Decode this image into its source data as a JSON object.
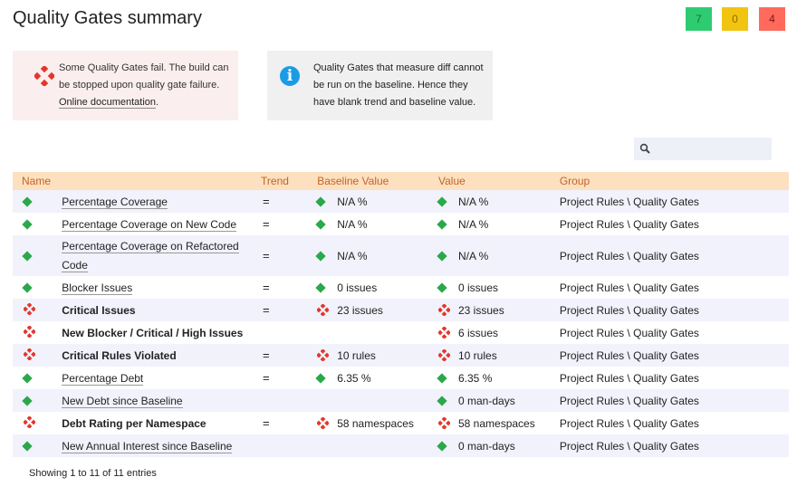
{
  "page": {
    "title": "Quality Gates summary"
  },
  "counters": {
    "pass": "7",
    "warn": "0",
    "fail": "4"
  },
  "colors": {
    "pass": "#2aa84a",
    "fail": "#e3362a",
    "header_bg": "#fde0bf",
    "header_text": "#c0642a"
  },
  "alerts": {
    "fail_text": "Some Quality Gates fail. The build can be stopped upon quality gate failure.",
    "fail_link": "Online documentation",
    "fail_icon": "red-diamond-fail-icon",
    "info_text": "Quality Gates that measure diff cannot be run on the baseline. Hence they have blank trend and baseline value.",
    "info_icon": "info-icon"
  },
  "search": {
    "value": "",
    "icon": "search-icon"
  },
  "table": {
    "headers": [
      "Name",
      "Trend",
      "Baseline Value",
      "Value",
      "Group"
    ],
    "rows": [
      {
        "status": "pass",
        "name": "Percentage Coverage",
        "bold": false,
        "trend": "=",
        "baseline": "N/A %",
        "baseline_status": "pass",
        "value": "N/A %",
        "value_status": "pass",
        "group": "Project Rules \\ Quality Gates"
      },
      {
        "status": "pass",
        "name": "Percentage Coverage on New Code",
        "bold": false,
        "trend": "=",
        "baseline": "N/A %",
        "baseline_status": "pass",
        "value": "N/A %",
        "value_status": "pass",
        "group": "Project Rules \\ Quality Gates"
      },
      {
        "status": "pass",
        "name": "Percentage Coverage on Refactored Code",
        "bold": false,
        "trend": "=",
        "baseline": "N/A %",
        "baseline_status": "pass",
        "value": "N/A %",
        "value_status": "pass",
        "group": "Project Rules \\ Quality Gates"
      },
      {
        "status": "pass",
        "name": "Blocker Issues",
        "bold": false,
        "trend": "=",
        "baseline": "0 issues",
        "baseline_status": "pass",
        "value": "0 issues",
        "value_status": "pass",
        "group": "Project Rules \\ Quality Gates"
      },
      {
        "status": "fail",
        "name": "Critical Issues",
        "bold": true,
        "trend": "=",
        "baseline": "23 issues",
        "baseline_status": "fail",
        "value": "23 issues",
        "value_status": "fail",
        "group": "Project Rules \\ Quality Gates"
      },
      {
        "status": "fail",
        "name": "New Blocker / Critical / High Issues",
        "bold": true,
        "trend": "",
        "baseline": "",
        "baseline_status": "",
        "value": "6 issues",
        "value_status": "fail",
        "group": "Project Rules \\ Quality Gates"
      },
      {
        "status": "fail",
        "name": "Critical Rules Violated",
        "bold": true,
        "trend": "=",
        "baseline": "10 rules",
        "baseline_status": "fail",
        "value": "10 rules",
        "value_status": "fail",
        "group": "Project Rules \\ Quality Gates"
      },
      {
        "status": "pass",
        "name": "Percentage Debt",
        "bold": false,
        "trend": "=",
        "baseline": "6.35 %",
        "baseline_status": "pass",
        "value": "6.35 %",
        "value_status": "pass",
        "group": "Project Rules \\ Quality Gates"
      },
      {
        "status": "pass",
        "name": "New Debt since Baseline",
        "bold": false,
        "trend": "",
        "baseline": "",
        "baseline_status": "",
        "value": "0 man-days",
        "value_status": "pass",
        "group": "Project Rules \\ Quality Gates"
      },
      {
        "status": "fail",
        "name": "Debt Rating per Namespace",
        "bold": true,
        "trend": "=",
        "baseline": "58 namespaces",
        "baseline_status": "fail",
        "value": "58 namespaces",
        "value_status": "fail",
        "group": "Project Rules \\ Quality Gates"
      },
      {
        "status": "pass",
        "name": "New Annual Interest since Baseline",
        "bold": false,
        "trend": "",
        "baseline": "",
        "baseline_status": "",
        "value": "0 man-days",
        "value_status": "pass",
        "group": "Project Rules \\ Quality Gates"
      }
    ]
  },
  "footer": {
    "entries": "Showing 1 to 11 of 11 entries"
  }
}
